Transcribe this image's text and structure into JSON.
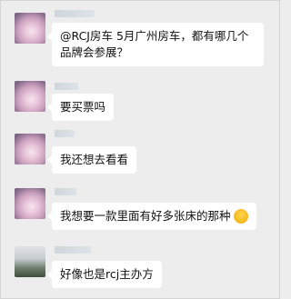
{
  "messages": [
    {
      "id": "m1",
      "avatar": "flower-avatar",
      "text": "@RCJ房车 5月广州房车，都有哪几个品牌会参展？"
    },
    {
      "id": "m2",
      "avatar": "flower-avatar",
      "text": "要买票吗"
    },
    {
      "id": "m3",
      "avatar": "flower-avatar",
      "text": "我还想去看看"
    },
    {
      "id": "m4",
      "avatar": "flower-avatar",
      "text": "我想要一款里面有好多张床的那种",
      "emoji": "sweat-smile-emoji"
    },
    {
      "id": "m5",
      "avatar": "photo-avatar",
      "text": "好像也是rcj主办方"
    }
  ]
}
